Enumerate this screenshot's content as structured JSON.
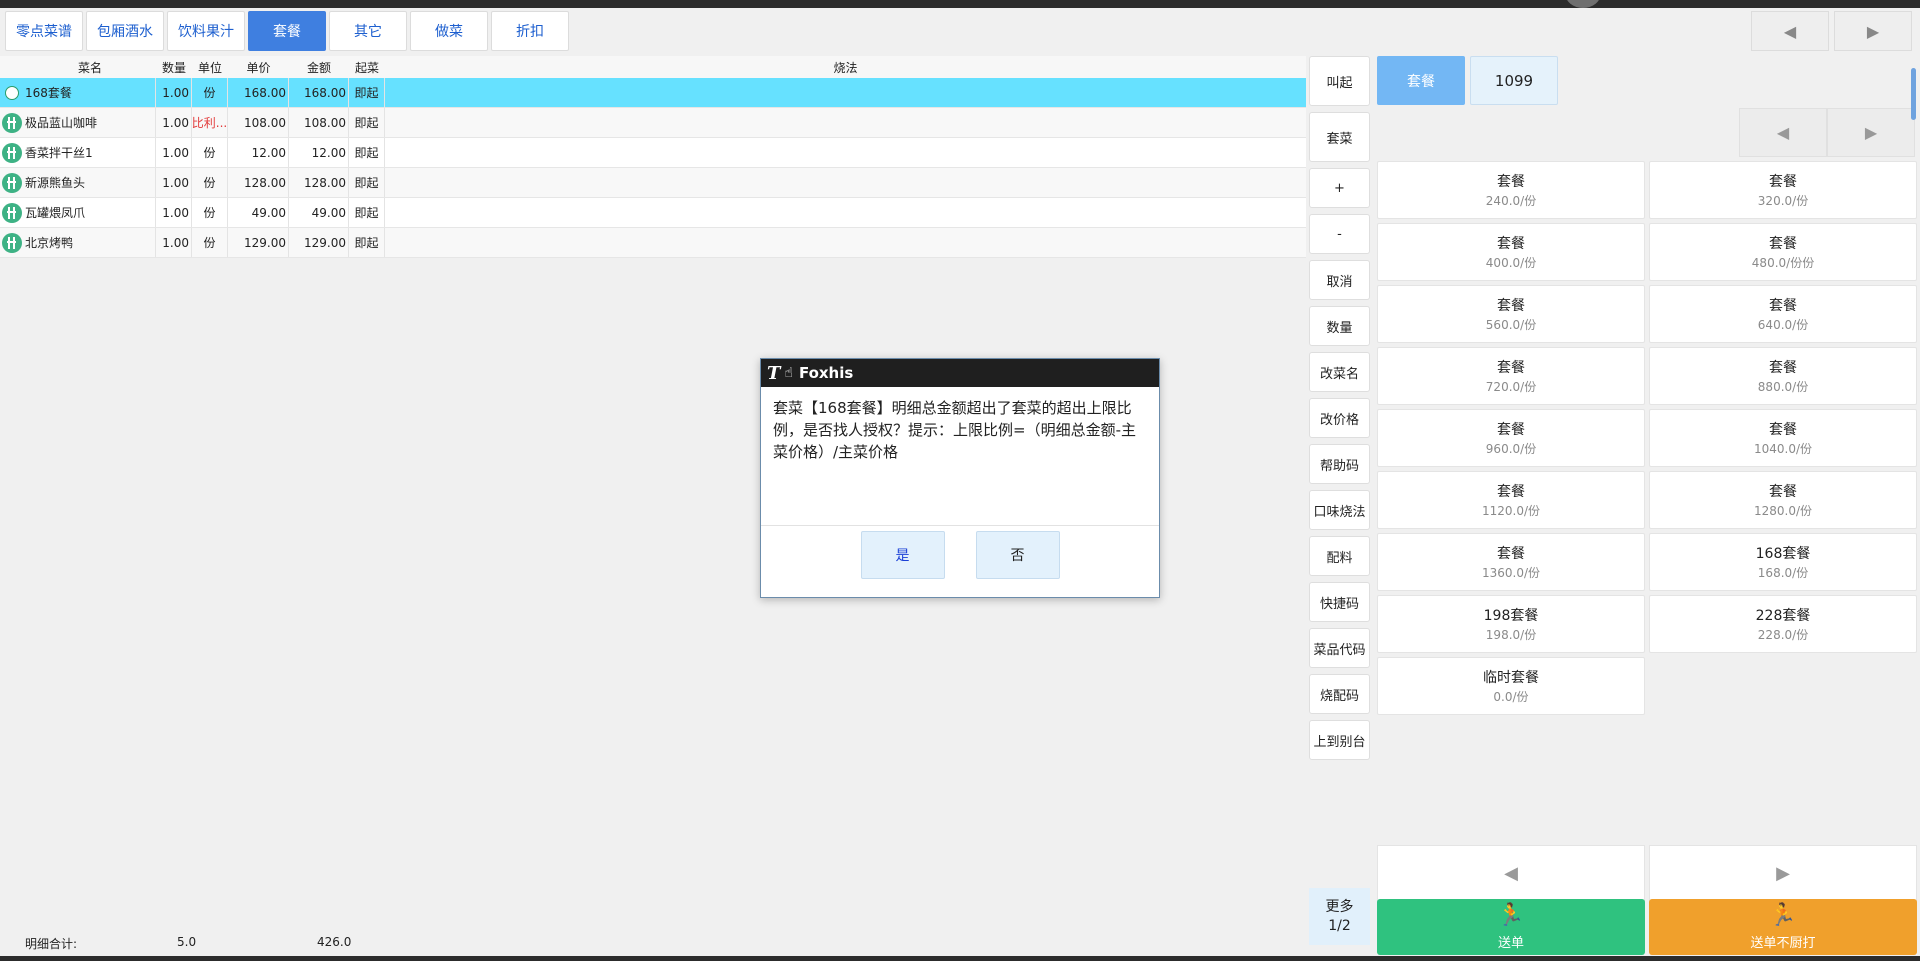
{
  "tabs": [
    "零点菜谱",
    "包厢酒水",
    "饮料果汁",
    "套餐",
    "其它",
    "做菜",
    "折扣"
  ],
  "active_tab": "套餐",
  "nav": {
    "prev": "◀",
    "next": "▶"
  },
  "grid": {
    "headers": {
      "name": "菜名",
      "qty": "数量",
      "unit": "单位",
      "price": "单价",
      "amount": "金额",
      "start": "起菜",
      "method": "烧法"
    },
    "rows": [
      {
        "name": "168套餐",
        "qty": "1.00",
        "unit": "份",
        "price": "168.00",
        "amount": "168.00",
        "start": "即起",
        "method": ""
      },
      {
        "name": "极品蓝山咖啡",
        "qty": "1.00",
        "unit": "比利...",
        "price": "108.00",
        "amount": "108.00",
        "start": "即起",
        "method": ""
      },
      {
        "name": "香菜拌干丝1",
        "qty": "1.00",
        "unit": "份",
        "price": "12.00",
        "amount": "12.00",
        "start": "即起",
        "method": ""
      },
      {
        "name": "新源熊鱼头",
        "qty": "1.00",
        "unit": "份",
        "price": "128.00",
        "amount": "128.00",
        "start": "即起",
        "method": ""
      },
      {
        "name": "瓦罐煨凤爪",
        "qty": "1.00",
        "unit": "份",
        "price": "49.00",
        "amount": "49.00",
        "start": "即起",
        "method": ""
      },
      {
        "name": "北京烤鸭",
        "qty": "1.00",
        "unit": "份",
        "price": "129.00",
        "amount": "129.00",
        "start": "即起",
        "method": ""
      }
    ]
  },
  "footer": {
    "label": "明细合计:",
    "qty_total": "5.0",
    "amount_total": "426.0"
  },
  "actions": [
    "叫起",
    "套菜",
    "+",
    "-",
    "取消",
    "数量",
    "改菜名",
    "改价格",
    "帮助码",
    "口味烧法",
    "配料",
    "快捷码",
    "菜品代码",
    "烧配码",
    "上到别台"
  ],
  "more": {
    "label": "更多",
    "page": "1/2"
  },
  "combo": {
    "category": "套餐",
    "number": "1099"
  },
  "menu_items": [
    {
      "name": "套餐",
      "price": "240.0/份"
    },
    {
      "name": "套餐",
      "price": "320.0/份"
    },
    {
      "name": "套餐",
      "price": "400.0/份"
    },
    {
      "name": "套餐",
      "price": "480.0/份份"
    },
    {
      "name": "套餐",
      "price": "560.0/份"
    },
    {
      "name": "套餐",
      "price": "640.0/份"
    },
    {
      "name": "套餐",
      "price": "720.0/份"
    },
    {
      "name": "套餐",
      "price": "880.0/份"
    },
    {
      "name": "套餐",
      "price": "960.0/份"
    },
    {
      "name": "套餐",
      "price": "1040.0/份"
    },
    {
      "name": "套餐",
      "price": "1120.0/份"
    },
    {
      "name": "套餐",
      "price": "1280.0/份"
    },
    {
      "name": "套餐",
      "price": "1360.0/份"
    },
    {
      "name": "168套餐",
      "price": "168.0/份"
    },
    {
      "name": "198套餐",
      "price": "198.0/份"
    },
    {
      "name": "228套餐",
      "price": "228.0/份"
    },
    {
      "name": "临时套餐",
      "price": "0.0/份"
    }
  ],
  "send": {
    "label": "送单",
    "color": "#2fc27f"
  },
  "send_no_print": {
    "label": "送单不厨打",
    "color": "#f0a02c"
  },
  "dialog": {
    "title": "Foxhis",
    "logo": "T",
    "message": "套菜【168套餐】明细总金额超出了套菜的超出上限比例，是否找人授权？提示：上限比例=（明细总金额-主菜价格）/主菜价格",
    "yes": "是",
    "no": "否"
  },
  "colors": {
    "accent": "#3f7fe0",
    "selected_row": "#66e1ff",
    "dish_icon": "#3eb285"
  }
}
